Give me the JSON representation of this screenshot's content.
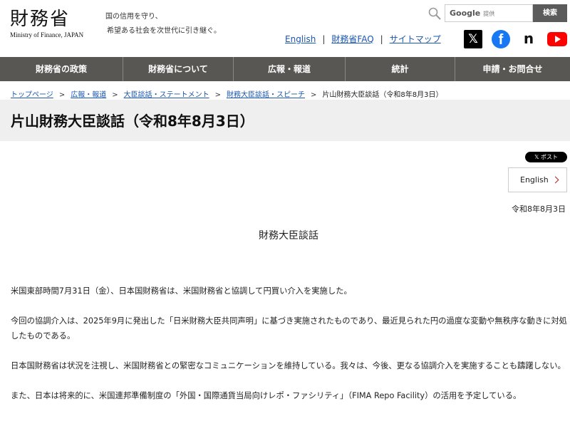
{
  "header": {
    "logo_main": "財務省",
    "logo_sub": "Ministry of Finance, JAPAN",
    "motto_line1": "国の信用を守り、",
    "motto_line2": "希望ある社会を次世代に引き継ぐ。",
    "search": {
      "provider": "Google",
      "provider_suffix": "提供",
      "button_label": "検索"
    },
    "util_links": [
      "English",
      "財務省FAQ",
      "サイトマップ"
    ],
    "social_icons": [
      "x-icon",
      "facebook-icon",
      "note-icon",
      "youtube-icon"
    ]
  },
  "gnav": {
    "items": [
      "財務省の政策",
      "財務省について",
      "広報・報道",
      "統計",
      "申請・お問合せ"
    ]
  },
  "breadcrumb": {
    "items": [
      "トップページ",
      "広報・報道",
      "大臣談話・ステートメント",
      "財務大臣談話・スピーチ"
    ],
    "current": "片山財務大臣談話（令和8年8月3日）"
  },
  "page": {
    "title": "片山財務大臣談話（令和8年8月3日）",
    "post_label": "ポスト",
    "english_label": "English",
    "date": "令和8年8月3日",
    "doc_heading": "財務大臣談話",
    "paragraphs": [
      "米国東部時間7月31日（金）、日本国財務省は、米国財務省と協調して円買い介入を実施した。",
      "今回の協調介入は、2025年9月に発出した「日米財務大臣共同声明」に基づき実施されたものであり、最近見られた円の過度な変動や無秩序な動きに対処したものである。",
      "日本国財務省は状況を注視し、米国財務省との緊密なコミュニケーションを維持している。我々は、今後、更なる協調介入を実施することも躊躇しない。",
      "また、日本は将来的に、米国連邦準備制度の「外国・国際通貨当局向けレポ・ファシリティ」（FIMA Repo Facility）の活用を予定している。"
    ]
  },
  "colors": {
    "nav_bg": "#595754",
    "link": "#1a56b0",
    "title_band": "#efefef"
  }
}
